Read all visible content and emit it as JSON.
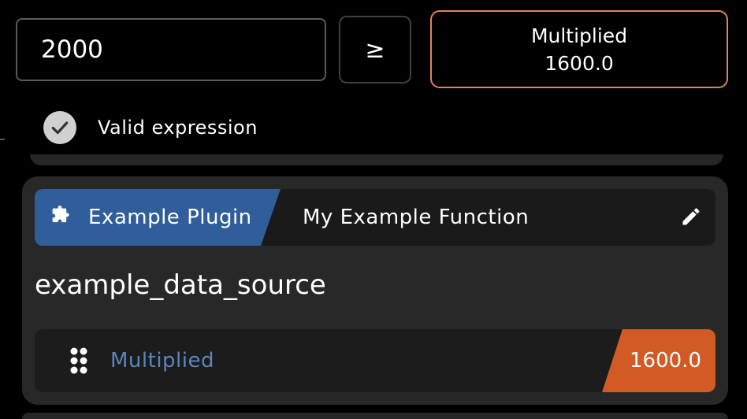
{
  "expression": {
    "input_value": "2000",
    "operator_label": "≥",
    "result": {
      "title": "Multiplied",
      "value": "1600.0"
    },
    "status_text": "Valid expression"
  },
  "card": {
    "plugin_label": "Example Plugin",
    "function_name": "My Example Function",
    "source_name": "example_data_source",
    "row": {
      "label": "Multiplied",
      "value": "1600.0"
    }
  },
  "colors": {
    "accent_orange": "#d15a25",
    "result_border": "#e0835a",
    "plugin_blue": "#2f5e9a",
    "label_blue": "#5b86bd",
    "card_bg": "#282828"
  },
  "icons": {
    "status": "check-circle-icon",
    "plugin": "puzzle-icon",
    "edit": "pencil-icon",
    "drag": "drag-handle-icon"
  }
}
